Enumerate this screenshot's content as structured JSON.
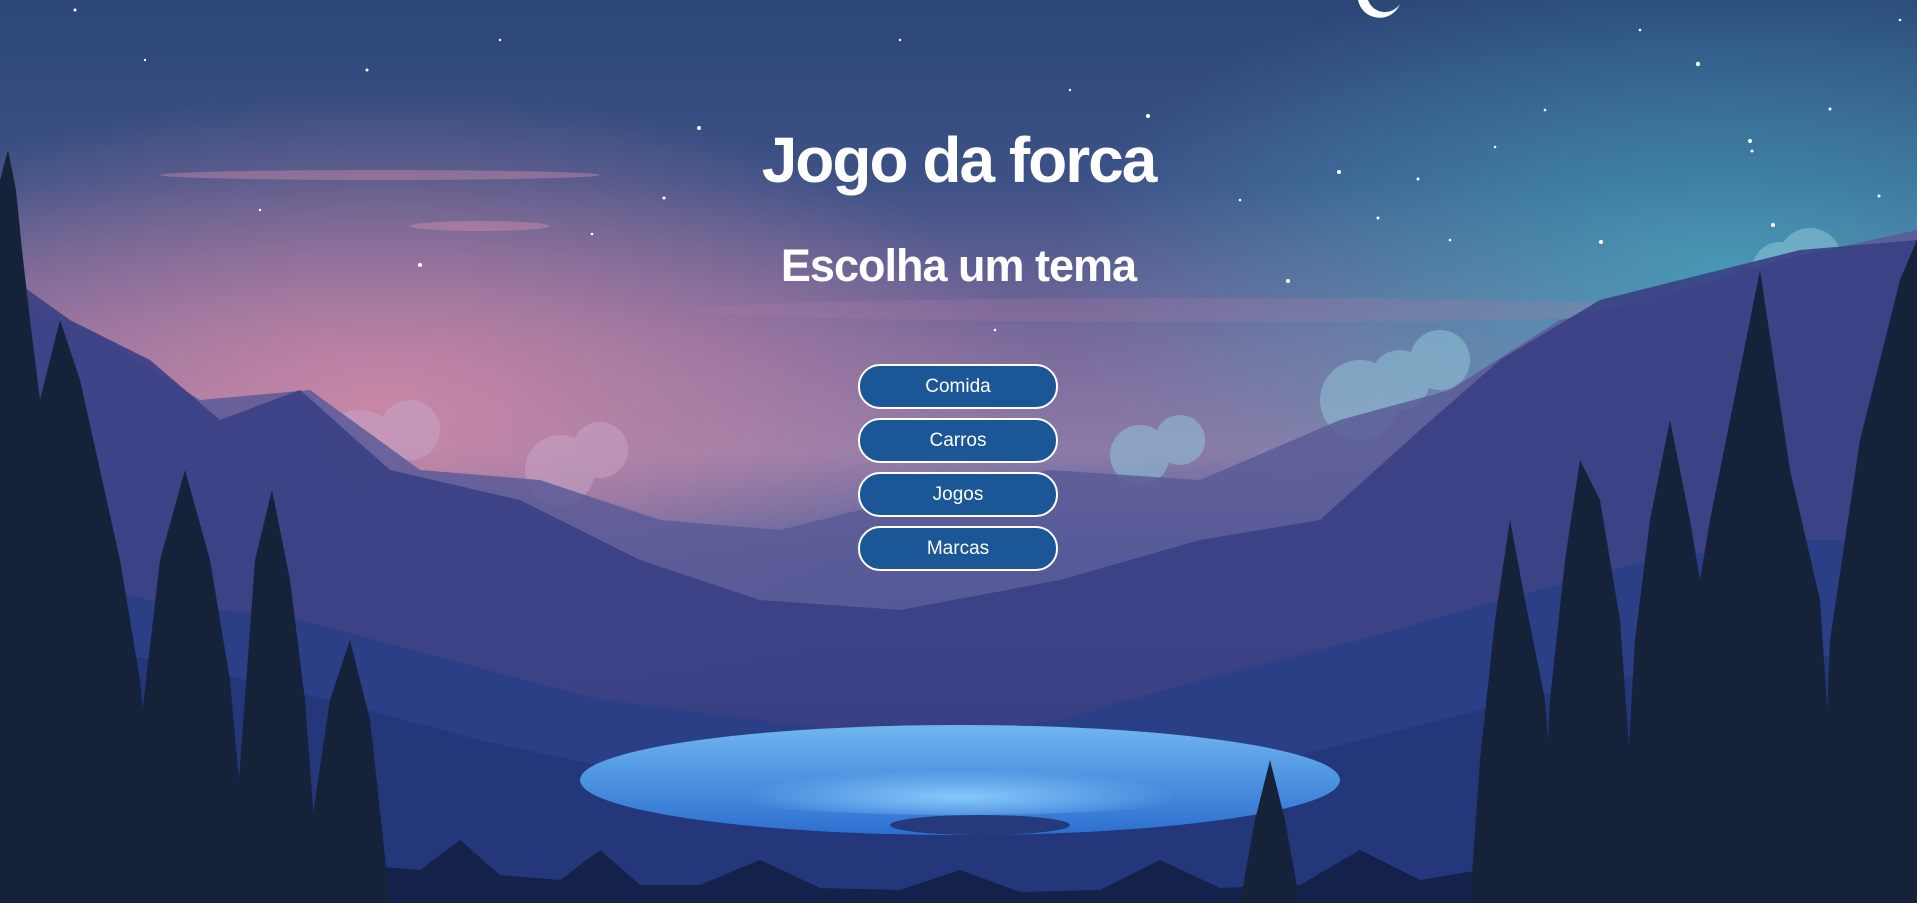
{
  "title": "Jogo da forca",
  "subtitle": "Escolha um tema",
  "themes": [
    {
      "label": "Comida"
    },
    {
      "label": "Carros"
    },
    {
      "label": "Jogos"
    },
    {
      "label": "Marcas"
    }
  ],
  "colors": {
    "button_bg": "#1b5696",
    "button_border": "#ffffff",
    "text": "#ffffff",
    "sky_top": "#2c4a7a",
    "sky_pink": "#c98aa8",
    "lake": "#4a9ee8"
  }
}
